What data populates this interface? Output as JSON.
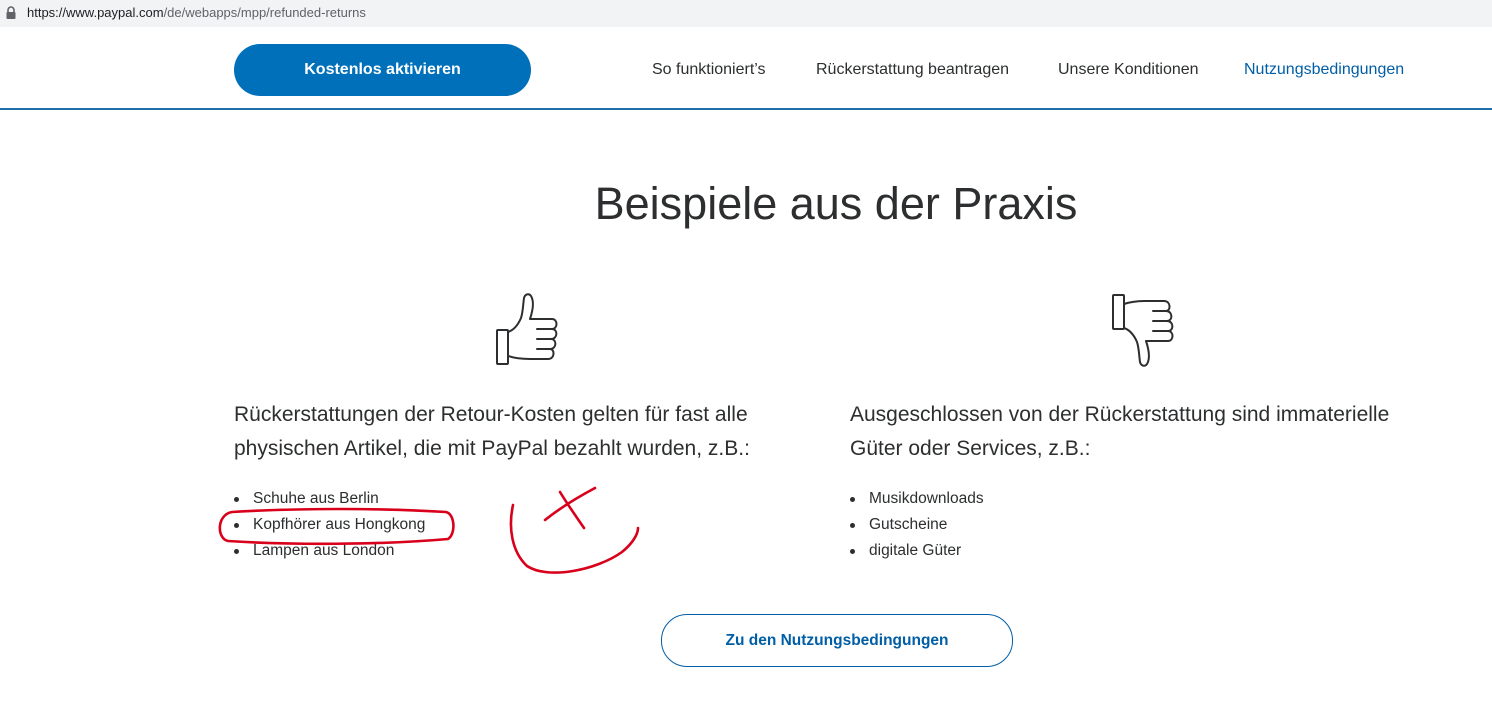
{
  "browser": {
    "url_host": "https://www.paypal.com",
    "url_path": "/de/webapps/mpp/refunded-returns"
  },
  "header": {
    "cta_label": "Kostenlos aktivieren",
    "nav": [
      {
        "label": "So funktioniert’s"
      },
      {
        "label": "Rückerstattung beantragen"
      },
      {
        "label": "Unsere Konditionen"
      },
      {
        "label": "Nutzungsbedingungen",
        "active": true
      }
    ]
  },
  "main": {
    "title": "Beispiele aus der Praxis",
    "included": {
      "icon": "thumbs-up-icon",
      "intro_line1": "Rückerstattungen der Retour-Kosten gelten für fast alle",
      "intro_line2": "physischen Artikel, die mit PayPal bezahlt wurden, z.B.:",
      "items": [
        "Schuhe aus Berlin",
        "Kopfhörer aus Hongkong",
        "Lampen aus London"
      ]
    },
    "excluded": {
      "icon": "thumbs-down-icon",
      "intro_line1": "Ausgeschlossen von der Rückerstattung sind immaterielle",
      "intro_line2": "Güter oder Services, z.B.:",
      "items": [
        "Musikdownloads",
        "Gutscheine",
        "digitale Güter"
      ]
    },
    "cta_label": "Zu den Nutzungsbedingungen"
  },
  "colors": {
    "primary": "#0070ba",
    "link": "#005ea6",
    "text": "#2c2e2f",
    "annotation": "#d9001b"
  }
}
